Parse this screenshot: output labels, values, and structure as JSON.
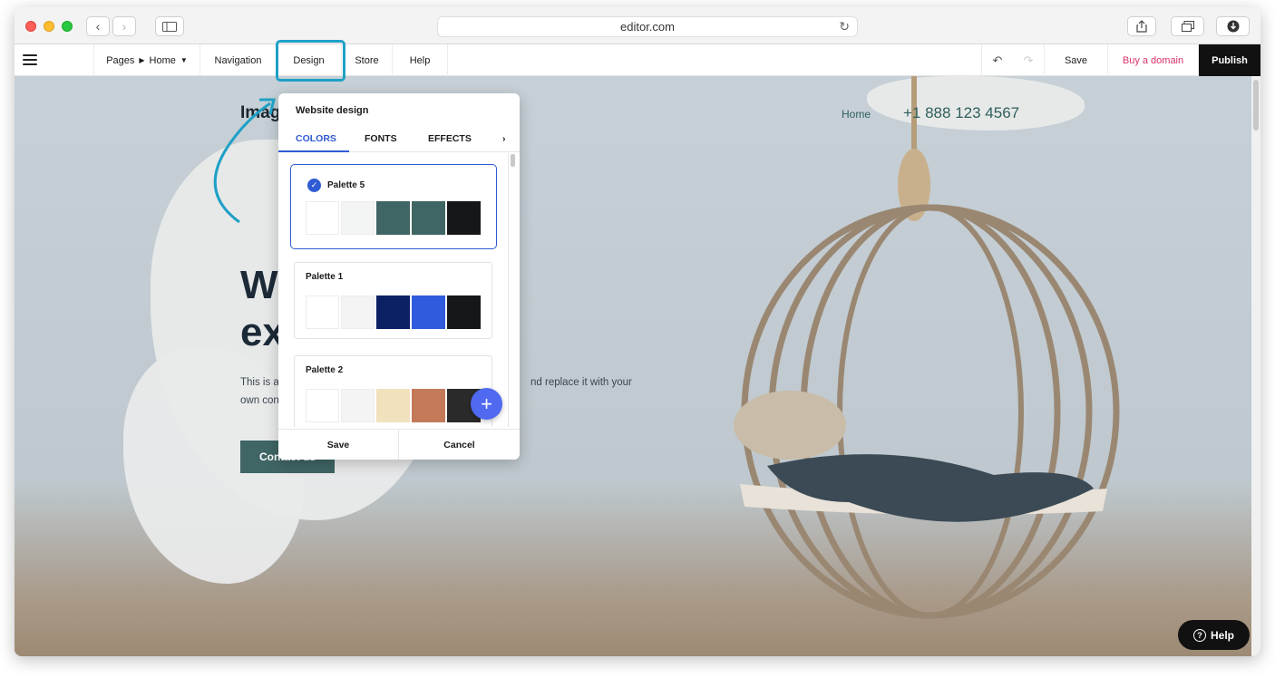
{
  "browser": {
    "url": "editor.com"
  },
  "toolbar": {
    "pages_label": "Pages",
    "home_label": "Home",
    "navigation": "Navigation",
    "design": "Design",
    "store": "Store",
    "help": "Help",
    "save": "Save",
    "buy_domain": "Buy a domain",
    "publish": "Publish"
  },
  "site": {
    "logo": "Imag",
    "nav_home": "Home",
    "phone": "+1 888 123 4567",
    "hero_line1": "W",
    "hero_line2": "ex",
    "hero_text_left": "This is a",
    "hero_text_right": "nd replace it with your",
    "hero_text_line2": "own con",
    "cta": "Contact us"
  },
  "design_panel": {
    "title": "Website design",
    "tabs": [
      "COLORS",
      "FONTS",
      "EFFECTS"
    ],
    "active_tab": "COLORS",
    "palettes": [
      {
        "name": "Palette 5",
        "selected": true,
        "colors": [
          "#ffffff",
          "#f3f4f4",
          "#3f6564",
          "#3f6564",
          "#161719"
        ]
      },
      {
        "name": "Palette 1",
        "selected": false,
        "colors": [
          "#ffffff",
          "#f4f4f5",
          "#0c2164",
          "#2f5bdc",
          "#161719"
        ]
      },
      {
        "name": "Palette 2",
        "selected": false,
        "colors": [
          "#ffffff",
          "#f4f4f4",
          "#f2e1bd",
          "#c47a58",
          "#2a2a2a"
        ]
      }
    ],
    "save": "Save",
    "cancel": "Cancel"
  },
  "help_button": "Help",
  "colors": {
    "accent_blue": "#2f5bd2",
    "highlight": "#1fa0c6",
    "buy_domain": "#d9316c"
  }
}
